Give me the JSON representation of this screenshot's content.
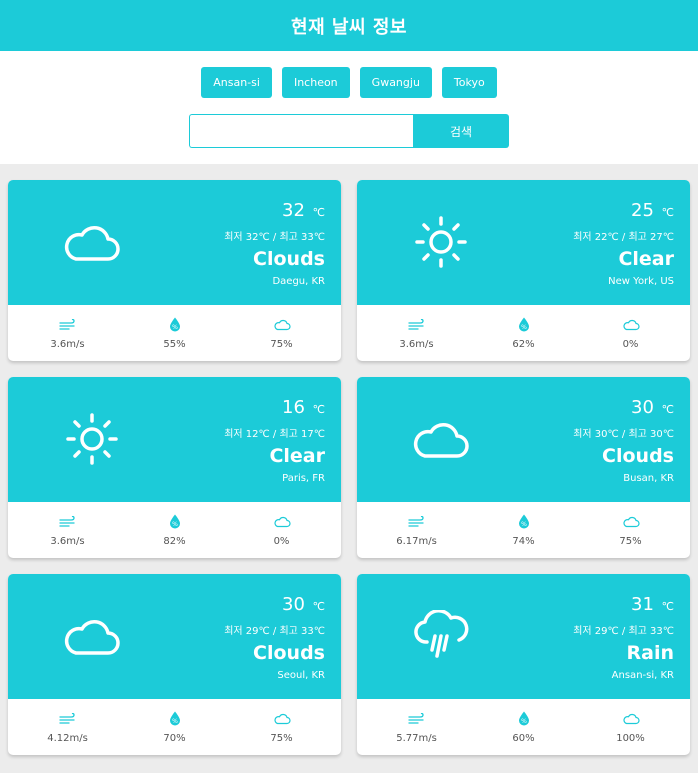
{
  "header": {
    "title": "현재 날씨 정보"
  },
  "city_buttons": [
    "Ansan-si",
    "Incheon",
    "Gwangju",
    "Tokyo"
  ],
  "search": {
    "value": "",
    "placeholder": "",
    "button_label": "검색"
  },
  "colors": {
    "accent": "#1ccbd8",
    "background": "#ececec"
  },
  "cards": [
    {
      "icon": "cloud-icon",
      "temp": "32",
      "unit": "℃",
      "minmax": "최저 32℃ / 최고 33℃",
      "desc": "Clouds",
      "place": "Daegu, KR",
      "wind": "3.6m/s",
      "humidity": "55%",
      "clouds": "75%"
    },
    {
      "icon": "sun-icon",
      "temp": "25",
      "unit": "℃",
      "minmax": "최저 22℃ / 최고 27℃",
      "desc": "Clear",
      "place": "New York, US",
      "wind": "3.6m/s",
      "humidity": "62%",
      "clouds": "0%"
    },
    {
      "icon": "sun-icon",
      "temp": "16",
      "unit": "℃",
      "minmax": "최저 12℃ / 최고 17℃",
      "desc": "Clear",
      "place": "Paris, FR",
      "wind": "3.6m/s",
      "humidity": "82%",
      "clouds": "0%"
    },
    {
      "icon": "cloud-icon",
      "temp": "30",
      "unit": "℃",
      "minmax": "최저 30℃ / 최고 30℃",
      "desc": "Clouds",
      "place": "Busan, KR",
      "wind": "6.17m/s",
      "humidity": "74%",
      "clouds": "75%"
    },
    {
      "icon": "cloud-icon",
      "temp": "30",
      "unit": "℃",
      "minmax": "최저 29℃ / 최고 33℃",
      "desc": "Clouds",
      "place": "Seoul, KR",
      "wind": "4.12m/s",
      "humidity": "70%",
      "clouds": "75%"
    },
    {
      "icon": "rain-icon",
      "temp": "31",
      "unit": "℃",
      "minmax": "최저 29℃ / 최고 33℃",
      "desc": "Rain",
      "place": "Ansan-si, KR",
      "wind": "5.77m/s",
      "humidity": "60%",
      "clouds": "100%"
    }
  ]
}
